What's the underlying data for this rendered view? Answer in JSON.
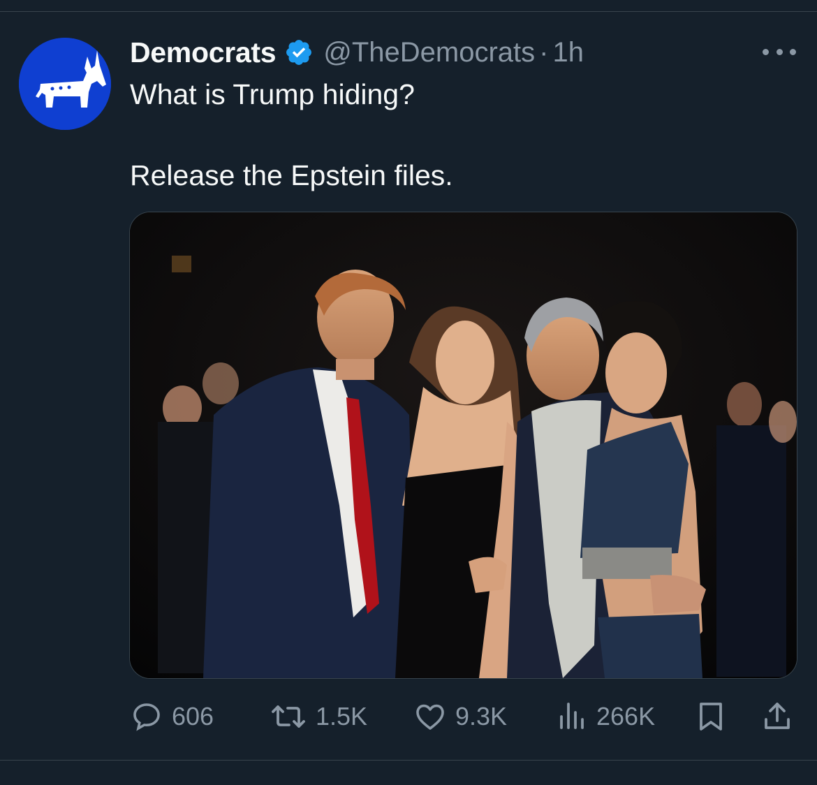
{
  "tweet": {
    "author_name": "Democrats",
    "author_handle": "@TheDemocrats",
    "separator": "·",
    "time": "1h",
    "text_line_1": "What is Trump hiding?",
    "text_line_2": "Release the Epstein files."
  },
  "icons": {
    "avatar": "democratic-donkey-logo",
    "verified": "verified-badge-icon",
    "more": "more-options-icon",
    "reply": "reply-icon",
    "retweet": "retweet-icon",
    "like": "like-icon",
    "views": "views-icon",
    "bookmark": "bookmark-icon",
    "share": "share-icon"
  },
  "actions": {
    "replies": "606",
    "retweets": "1.5K",
    "likes": "9.3K",
    "views": "266K"
  },
  "colors": {
    "background": "#15202b",
    "text": "#f7f9f9",
    "secondary": "#8b98a5",
    "accent": "#1d9bf0",
    "avatar_blue": "#0f3fd1"
  }
}
